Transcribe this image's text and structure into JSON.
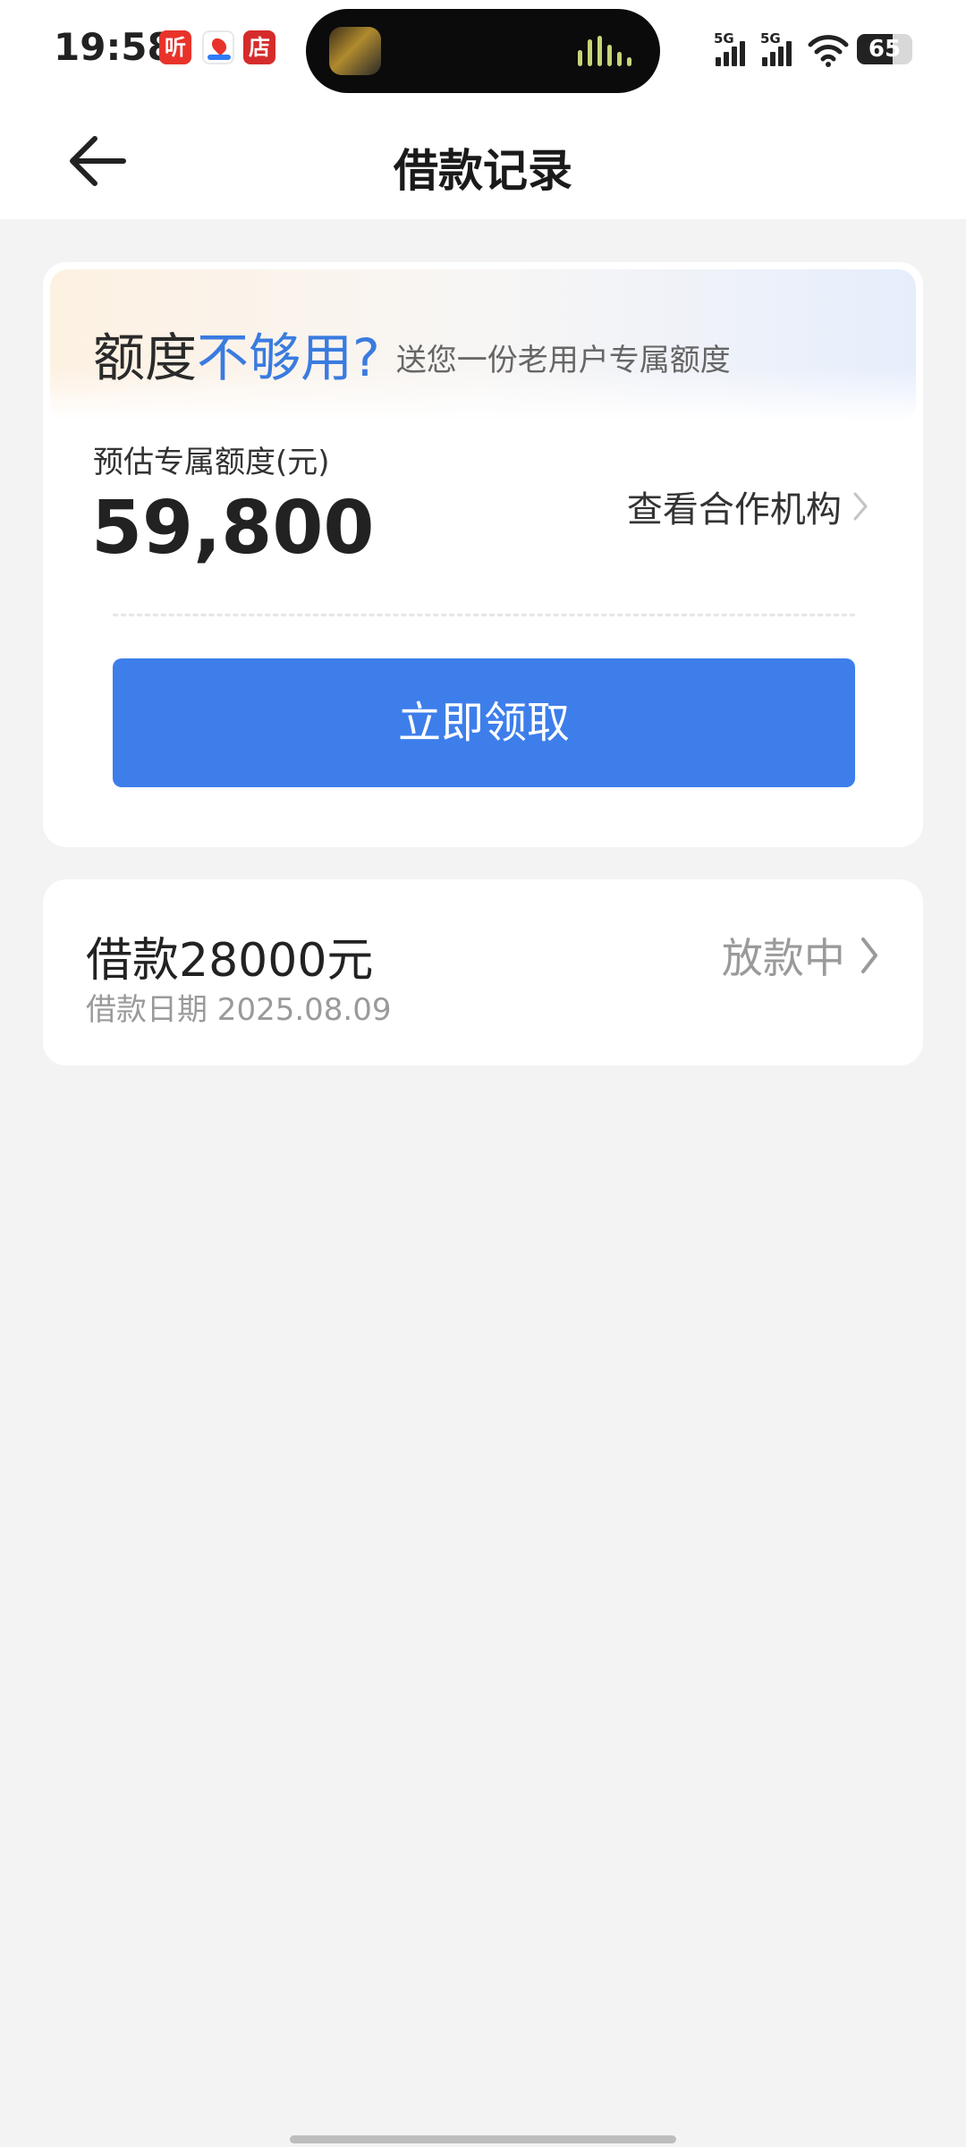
{
  "status_bar": {
    "time": "19:58",
    "app_icons": [
      {
        "name": "ting-app-icon",
        "glyph": "听"
      },
      {
        "name": "map-app-icon",
        "glyph": ""
      },
      {
        "name": "store-app-icon",
        "glyph": "店"
      }
    ],
    "signal_1": "5G",
    "signal_2": "5G",
    "battery": "65",
    "battery_level": 0.65
  },
  "nav": {
    "title": "借款记录",
    "back_icon": "arrow-left-icon"
  },
  "promo": {
    "heading_dark": "额度",
    "heading_blue": "不够用?",
    "subtitle": "送您一份老用户专属额度",
    "quota_label": "预估专属额度(元)",
    "quota_value": "59,800",
    "partner_link": "查看合作机构",
    "claim_button": "立即领取"
  },
  "loans": [
    {
      "title": "借款28000元",
      "date": "借款日期 2025.08.09",
      "status": "放款中"
    }
  ],
  "colors": {
    "accent": "#3d7eeb",
    "highlight_blue": "#3a7be0",
    "muted_text": "#9a9a9a",
    "page_bg": "#f3f3f3"
  }
}
